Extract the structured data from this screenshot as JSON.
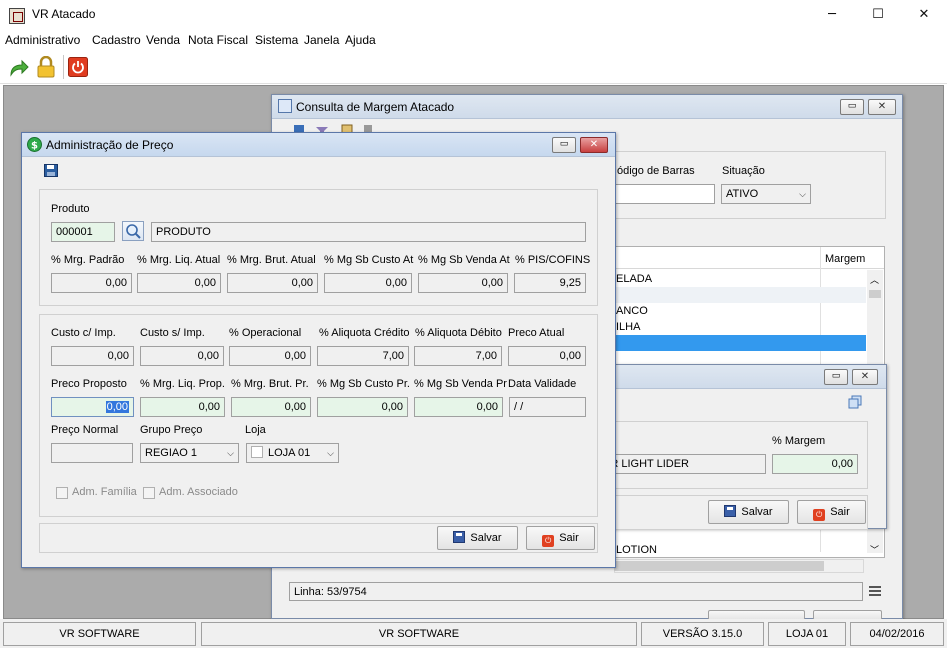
{
  "app": {
    "title": "VR Atacado",
    "minimize": "─",
    "maximize": "☐",
    "close": "✕"
  },
  "menu": [
    "Administrativo",
    "Cadastro",
    "Venda",
    "Nota Fiscal",
    "Sistema",
    "Janela",
    "Ajuda"
  ],
  "toolbar": {
    "icons": [
      "forward-arrow-icon",
      "lock-icon",
      "power-icon"
    ]
  },
  "status": {
    "cell1": "VR SOFTWARE",
    "cell2": "VR SOFTWARE",
    "version": "VERSÃO 3.15.0",
    "store": "LOJA 01",
    "date": "04/02/2016"
  },
  "consulta": {
    "title": "Consulta de Margem Atacado",
    "barcode_label": "ódigo de Barras",
    "situacao_label": "Situação",
    "situacao_value": "ATIVO",
    "grid_header_margem": "Margem",
    "rows": [
      "ELADA",
      "",
      "ANCO",
      "ILHA",
      ""
    ],
    "bottom_row": "LOTION",
    "linha": "Linha: 53/9754"
  },
  "subwin": {
    "margem_label": "% Margem",
    "product_text": "SR LIGHT LIDER",
    "margem_value": "0,00",
    "salvar": "Salvar",
    "sair": "Sair"
  },
  "admin": {
    "title": "Administração de Preço",
    "produto_label": "Produto",
    "produto_code": "000001",
    "produto_desc": "PRODUTO",
    "row1_labels": [
      "% Mrg. Padrão",
      "% Mrg. Liq. Atual",
      "% Mrg. Brut. Atual",
      "% Mg Sb Custo At",
      "% Mg Sb Venda At",
      "% PIS/COFINS"
    ],
    "row1_values": [
      "0,00",
      "0,00",
      "0,00",
      "0,00",
      "0,00",
      "9,25"
    ],
    "row2_labels": [
      "Custo c/ Imp.",
      "Custo s/ Imp.",
      "% Operacional",
      "% Aliquota Crédito",
      "% Aliquota Débito",
      "Preco Atual"
    ],
    "row2_values": [
      "0,00",
      "0,00",
      "0,00",
      "7,00",
      "7,00",
      "0,00"
    ],
    "row3_labels": [
      "Preco Proposto",
      "% Mrg. Liq. Prop.",
      "% Mrg. Brut. Pr.",
      "% Mg Sb Custo Pr.",
      "% Mg Sb Venda Pr",
      "Data Validade"
    ],
    "row3_values": [
      "0,00",
      "0,00",
      "0,00",
      "0,00",
      "0,00",
      " /  /"
    ],
    "preco_normal_label": "Preço Normal",
    "grupo_label": "Grupo Preço",
    "grupo_value": "REGIAO 1",
    "loja_label": "Loja",
    "loja_value": "LOJA 01",
    "adm_familia": "Adm. Família",
    "adm_associado": "Adm. Associado",
    "salvar": "Salvar",
    "sair": "Sair"
  }
}
